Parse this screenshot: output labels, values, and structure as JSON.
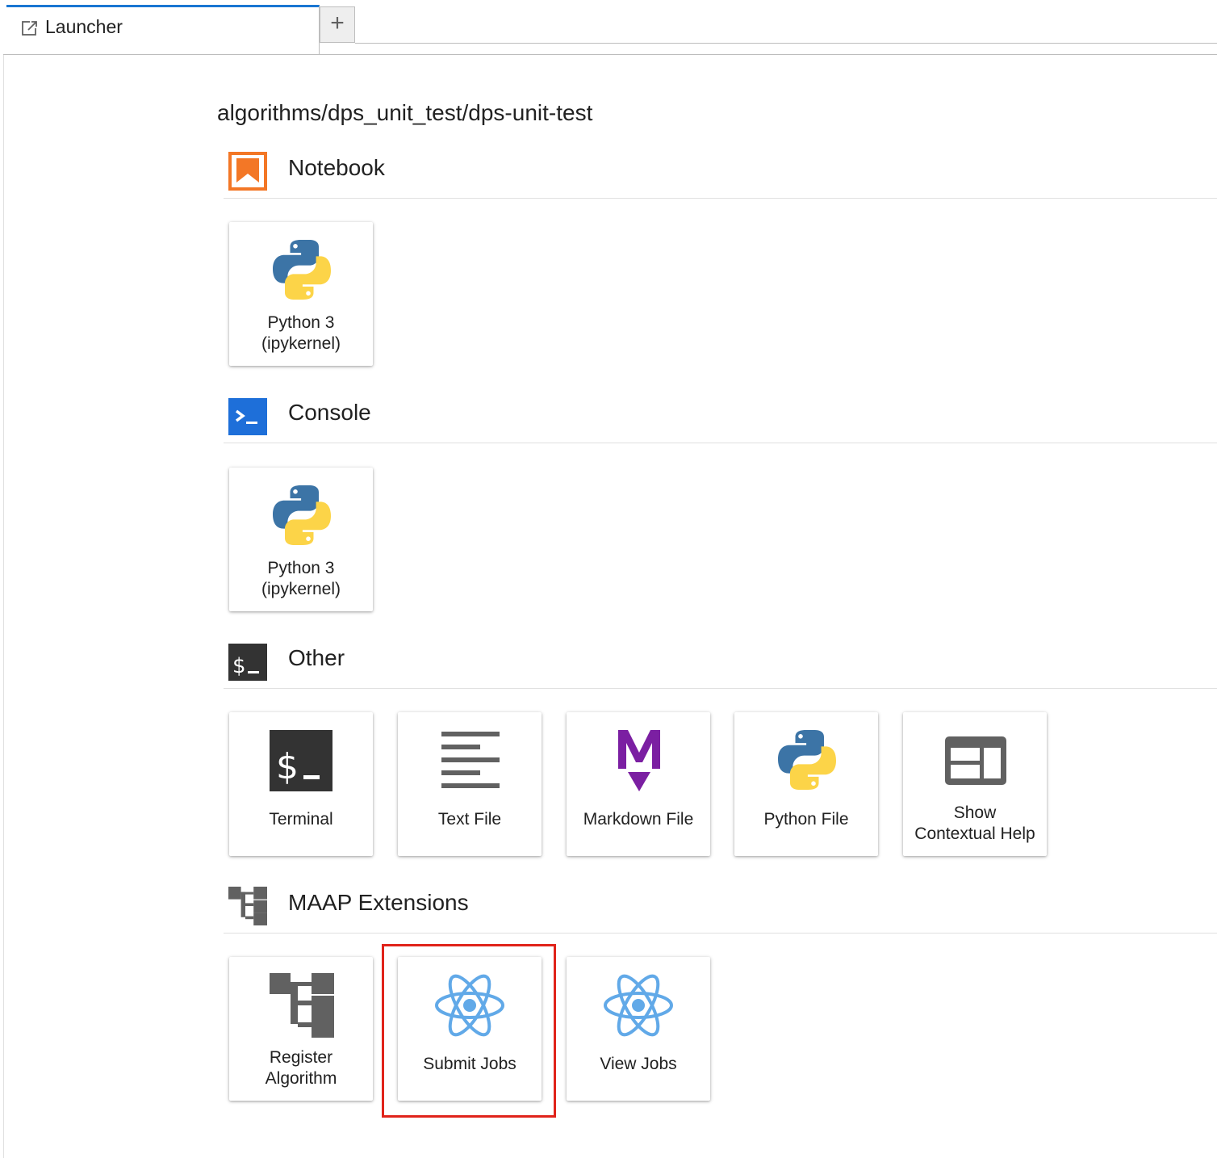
{
  "tabs": {
    "active_label": "Launcher",
    "active_icon": "launch-icon",
    "add_label": "+"
  },
  "launcher": {
    "path": "algorithms/dps_unit_test/dps-unit-test",
    "sections": {
      "notebook": {
        "title": "Notebook",
        "icon": "notebook-icon",
        "items": [
          {
            "label": "Python 3\n(ipykernel)",
            "icon": "python-logo-icon"
          }
        ]
      },
      "console": {
        "title": "Console",
        "icon": "console-icon",
        "items": [
          {
            "label": "Python 3\n(ipykernel)",
            "icon": "python-logo-icon"
          }
        ]
      },
      "other": {
        "title": "Other",
        "icon": "terminal-icon",
        "items": [
          {
            "label": "Terminal",
            "icon": "terminal-icon"
          },
          {
            "label": "Text File",
            "icon": "text-file-icon"
          },
          {
            "label": "Markdown File",
            "icon": "markdown-icon"
          },
          {
            "label": "Python File",
            "icon": "python-logo-icon"
          },
          {
            "label": "Show\nContextual Help",
            "icon": "contextual-help-icon"
          }
        ]
      },
      "maap": {
        "title": "MAAP Extensions",
        "icon": "algorithm-tree-icon",
        "items": [
          {
            "label": "Register\nAlgorithm",
            "icon": "algorithm-tree-icon"
          },
          {
            "label": "Submit Jobs",
            "icon": "react-atom-icon",
            "highlighted": true
          },
          {
            "label": "View Jobs",
            "icon": "react-atom-icon"
          }
        ]
      }
    }
  },
  "colors": {
    "accent": "#1976d2",
    "notebook_orange": "#f37726",
    "console_blue": "#1e6fd9",
    "dark_icon": "#333333",
    "markdown_purple": "#7b1fa2",
    "react_blue": "#61a9e8",
    "highlight_red": "#e0231a"
  }
}
